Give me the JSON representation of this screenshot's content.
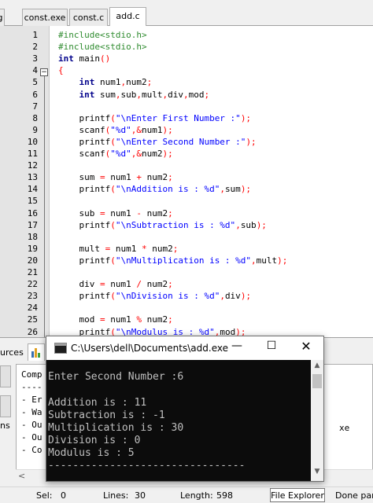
{
  "tabs": [
    {
      "label": "g"
    },
    {
      "label": "const.exe"
    },
    {
      "label": "const.c"
    },
    {
      "label": "add.c",
      "active": true
    }
  ],
  "code_lines": [
    {
      "n": "1",
      "segs": [
        [
          "pre",
          "#include<stdio.h>"
        ]
      ]
    },
    {
      "n": "2",
      "segs": [
        [
          "pre",
          "#include<stdio.h>"
        ]
      ]
    },
    {
      "n": "3",
      "segs": [
        [
          "kw",
          "int"
        ],
        [
          "norm",
          " main"
        ],
        [
          "op",
          "()"
        ]
      ]
    },
    {
      "n": "4",
      "segs": [
        [
          "op",
          "{"
        ]
      ]
    },
    {
      "n": "5",
      "segs": [
        [
          "kw",
          "    int"
        ],
        [
          "norm",
          " num1"
        ],
        [
          "op",
          ","
        ],
        [
          "norm",
          "num2"
        ],
        [
          "op",
          ";"
        ]
      ]
    },
    {
      "n": "6",
      "segs": [
        [
          "kw",
          "    int"
        ],
        [
          "norm",
          " sum"
        ],
        [
          "op",
          ","
        ],
        [
          "norm",
          "sub"
        ],
        [
          "op",
          ","
        ],
        [
          "norm",
          "mult"
        ],
        [
          "op",
          ","
        ],
        [
          "norm",
          "div"
        ],
        [
          "op",
          ","
        ],
        [
          "norm",
          "mod"
        ],
        [
          "op",
          ";"
        ]
      ]
    },
    {
      "n": "7",
      "segs": []
    },
    {
      "n": "8",
      "segs": [
        [
          "norm",
          "    printf"
        ],
        [
          "op",
          "("
        ],
        [
          "str",
          "\"\\nEnter First Number :\""
        ],
        [
          "op",
          ");"
        ]
      ]
    },
    {
      "n": "9",
      "segs": [
        [
          "norm",
          "    scanf"
        ],
        [
          "op",
          "("
        ],
        [
          "str",
          "\"%d\""
        ],
        [
          "op",
          ",&"
        ],
        [
          "norm",
          "num1"
        ],
        [
          "op",
          ");"
        ]
      ]
    },
    {
      "n": "10",
      "segs": [
        [
          "norm",
          "    printf"
        ],
        [
          "op",
          "("
        ],
        [
          "str",
          "\"\\nEnter Second Number :\""
        ],
        [
          "op",
          ");"
        ]
      ]
    },
    {
      "n": "11",
      "segs": [
        [
          "norm",
          "    scanf"
        ],
        [
          "op",
          "("
        ],
        [
          "str",
          "\"%d\""
        ],
        [
          "op",
          ",&"
        ],
        [
          "norm",
          "num2"
        ],
        [
          "op",
          ");"
        ]
      ]
    },
    {
      "n": "12",
      "segs": []
    },
    {
      "n": "13",
      "segs": [
        [
          "norm",
          "    sum "
        ],
        [
          "op",
          "="
        ],
        [
          "norm",
          " num1 "
        ],
        [
          "op",
          "+"
        ],
        [
          "norm",
          " num2"
        ],
        [
          "op",
          ";"
        ]
      ]
    },
    {
      "n": "14",
      "segs": [
        [
          "norm",
          "    printf"
        ],
        [
          "op",
          "("
        ],
        [
          "str",
          "\"\\nAddition is : %d\""
        ],
        [
          "op",
          ","
        ],
        [
          "norm",
          "sum"
        ],
        [
          "op",
          ");"
        ]
      ]
    },
    {
      "n": "15",
      "segs": []
    },
    {
      "n": "16",
      "segs": [
        [
          "norm",
          "    sub "
        ],
        [
          "op",
          "="
        ],
        [
          "norm",
          " num1 "
        ],
        [
          "op",
          "-"
        ],
        [
          "norm",
          " num2"
        ],
        [
          "op",
          ";"
        ]
      ]
    },
    {
      "n": "17",
      "segs": [
        [
          "norm",
          "    printf"
        ],
        [
          "op",
          "("
        ],
        [
          "str",
          "\"\\nSubtraction is : %d\""
        ],
        [
          "op",
          ","
        ],
        [
          "norm",
          "sub"
        ],
        [
          "op",
          ");"
        ]
      ]
    },
    {
      "n": "18",
      "segs": []
    },
    {
      "n": "19",
      "segs": [
        [
          "norm",
          "    mult "
        ],
        [
          "op",
          "="
        ],
        [
          "norm",
          " num1 "
        ],
        [
          "op",
          "*"
        ],
        [
          "norm",
          " num2"
        ],
        [
          "op",
          ";"
        ]
      ]
    },
    {
      "n": "20",
      "segs": [
        [
          "norm",
          "    printf"
        ],
        [
          "op",
          "("
        ],
        [
          "str",
          "\"\\nMultiplication is : %d\""
        ],
        [
          "op",
          ","
        ],
        [
          "norm",
          "mult"
        ],
        [
          "op",
          ");"
        ]
      ]
    },
    {
      "n": "21",
      "segs": []
    },
    {
      "n": "22",
      "segs": [
        [
          "norm",
          "    div "
        ],
        [
          "op",
          "="
        ],
        [
          "norm",
          " num1 "
        ],
        [
          "op",
          "/"
        ],
        [
          "norm",
          " num2"
        ],
        [
          "op",
          ";"
        ]
      ]
    },
    {
      "n": "23",
      "segs": [
        [
          "norm",
          "    printf"
        ],
        [
          "op",
          "("
        ],
        [
          "str",
          "\"\\nDivision is : %d\""
        ],
        [
          "op",
          ","
        ],
        [
          "norm",
          "div"
        ],
        [
          "op",
          ");"
        ]
      ]
    },
    {
      "n": "24",
      "segs": []
    },
    {
      "n": "25",
      "segs": [
        [
          "norm",
          "    mod "
        ],
        [
          "op",
          "="
        ],
        [
          "norm",
          " num1 "
        ],
        [
          "op",
          "%"
        ],
        [
          "norm",
          " num2"
        ],
        [
          "op",
          ";"
        ]
      ]
    },
    {
      "n": "26",
      "segs": [
        [
          "norm",
          "    printf"
        ],
        [
          "op",
          "("
        ],
        [
          "str",
          "\"\\nModulus is : %d\""
        ],
        [
          "op",
          ","
        ],
        [
          "norm",
          "mod"
        ],
        [
          "op",
          ");"
        ]
      ]
    }
  ],
  "fold_symbol": "−",
  "bottom": {
    "sources_tab": "urces",
    "side_label": "ns",
    "log_lines": [
      "Comp",
      "----",
      "- Er",
      "- Wa",
      "- Ou",
      "- Ou",
      "- Co"
    ],
    "log_tail": "xe",
    "scroll_left": "<"
  },
  "console": {
    "title": "C:\\Users\\dell\\Documents\\add.exe",
    "minimize": "—",
    "maximize": "☐",
    "close": "✕",
    "lines": [
      "Enter Second Number :6",
      "",
      "Addition is : 11",
      "Subtraction is : -1",
      "Multiplication is : 30",
      "Division is : 0",
      "Modulus is : 5",
      "--------------------------------"
    ],
    "scroll_up": "▲",
    "scroll_down": "▼"
  },
  "status": {
    "sel_label": "Sel:",
    "sel_value": "0",
    "lines_label": "Lines:",
    "lines_value": "30",
    "length_label": "Length:",
    "length_value": "598",
    "file_explorer": "File Explorer",
    "done": "Done par"
  },
  "colors": {
    "preprocessor": "#2e8b2e",
    "keyword": "#00008b",
    "string": "#0000ff",
    "operator": "#ff0000",
    "console_bg": "#0c0c0c",
    "console_text": "#c0c0c0"
  }
}
